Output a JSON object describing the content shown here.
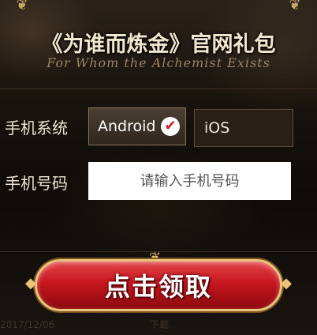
{
  "header": {
    "title": "《为谁而炼金》官网礼包",
    "subtitle": "For Whom the Alchemist Exists"
  },
  "form": {
    "system_label": "手机系统",
    "android_label": "Android",
    "ios_label": "iOS",
    "phone_label": "手机号码",
    "phone_placeholder": "请输入手机号码",
    "phone_value": ""
  },
  "claim_button": {
    "label": "点击领取"
  },
  "background": {
    "date_fragment": "2017/12/06",
    "download_fragment": "下载"
  },
  "colors": {
    "accent_red": "#c8161e",
    "gold": "#e8c47a",
    "check_red": "#c41e1e"
  },
  "icons": {
    "corner_ornament": "ornament",
    "android_selected": "check-icon"
  }
}
